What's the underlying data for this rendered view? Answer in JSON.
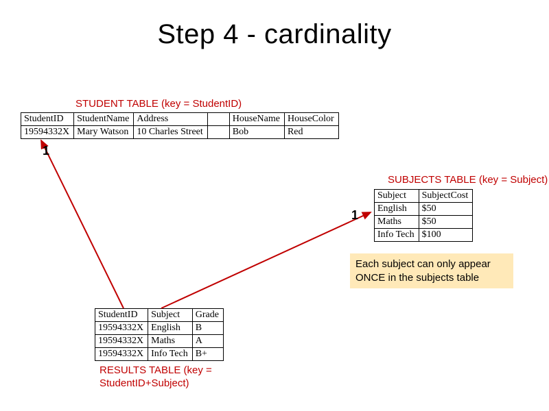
{
  "title": "Step 4 - cardinality",
  "labels": {
    "student": "STUDENT TABLE (key = StudentID)",
    "subjects": "SUBJECTS TABLE (key = Subject)",
    "results": "RESULTS TABLE (key = StudentID+Subject)"
  },
  "cardinality": {
    "a": "1",
    "b": "1"
  },
  "note": "Each subject can only appear ONCE in the subjects table",
  "student": {
    "headers": {
      "c1": "StudentID",
      "c2": "StudentName",
      "c3": "Address",
      "c4": "",
      "c5": "HouseName",
      "c6": "HouseColor"
    },
    "rows": [
      {
        "c1": "19594332X",
        "c2": "Mary Watson",
        "c3": "10 Charles Street",
        "c4": "",
        "c5": "Bob",
        "c6": "Red"
      }
    ]
  },
  "subjects": {
    "headers": {
      "c1": "Subject",
      "c2": "SubjectCost"
    },
    "rows": [
      {
        "c1": "English",
        "c2": "$50"
      },
      {
        "c1": "Maths",
        "c2": "$50"
      },
      {
        "c1": "Info Tech",
        "c2": "$100"
      }
    ]
  },
  "results": {
    "headers": {
      "c1": "StudentID",
      "c2": "Subject",
      "c3": "Grade"
    },
    "rows": [
      {
        "c1": "19594332X",
        "c2": "English",
        "c3": "B"
      },
      {
        "c1": "19594332X",
        "c2": "Maths",
        "c3": "A"
      },
      {
        "c1": "19594332X",
        "c2": "Info Tech",
        "c3": "B+"
      }
    ]
  }
}
